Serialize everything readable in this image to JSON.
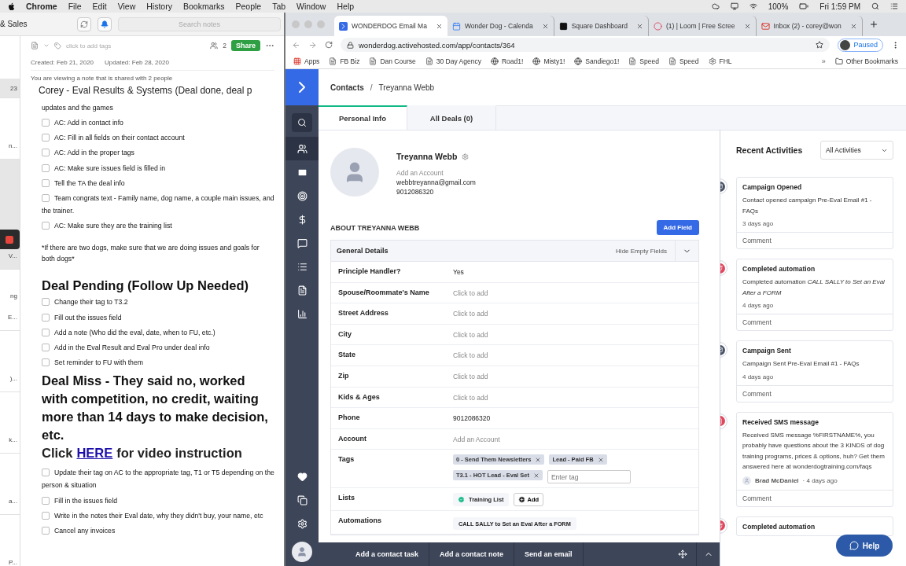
{
  "menubar": {
    "items": [
      {
        "label": "Chrome"
      },
      {
        "label": "File"
      },
      {
        "label": "Edit"
      },
      {
        "label": "View"
      },
      {
        "label": "History"
      },
      {
        "label": "Bookmarks"
      },
      {
        "label": "People"
      },
      {
        "label": "Tab"
      },
      {
        "label": "Window"
      },
      {
        "label": "Help"
      }
    ],
    "battery": "100%",
    "clock": "Fri 1:59 PM"
  },
  "notes_app": {
    "notebook": "& Sales",
    "search": {
      "placeholder": "Search notes"
    },
    "note_list": [
      {
        "lines": [
          "23"
        ],
        "kind": "date"
      },
      {
        "lines": [
          "n..."
        ],
        "kind": "snippet"
      },
      {
        "lines": [
          "V..."
        ],
        "kind": "active"
      },
      {
        "lines": [
          "ng",
          "E..."
        ],
        "kind": "snippet"
      },
      {
        "lines": [
          ")..."
        ],
        "kind": "snippet"
      },
      {
        "lines": [
          "k..."
        ],
        "kind": "snippet"
      },
      {
        "lines": [
          "a..."
        ],
        "kind": "snippet"
      },
      {
        "lines": [
          "P..."
        ],
        "kind": "snippet"
      }
    ],
    "tags_placeholder": "click to add tags",
    "shared_count": "2",
    "share": "Share",
    "created": "Created: Feb 21, 2020",
    "updated": "Updated: Feb 28, 2020",
    "banner": "You are viewing a note that is shared with 2 people",
    "title": "Corey - Eval Results & Systems (Deal done, deal p",
    "blocks": [
      {
        "kind": "text",
        "text": "updates and the games"
      },
      {
        "kind": "check",
        "text": "AC: Add in contact info",
        "checked": false
      },
      {
        "kind": "check",
        "text": "AC: Fill in all fields on their contact account",
        "checked": false
      },
      {
        "kind": "check",
        "text": "AC: Add in the proper tags",
        "checked": false
      },
      {
        "kind": "check",
        "text": "AC: Make sure issues field is filled in",
        "checked": false
      },
      {
        "kind": "check",
        "text": "Tell the TA the deal info",
        "checked": false
      },
      {
        "kind": "check",
        "text": "Team congrats text - Family name, dog name, a couple main issues, and the trainer.",
        "checked": false
      },
      {
        "kind": "check",
        "text": "AC: Make sure they are the training list",
        "checked": false
      },
      {
        "kind": "note",
        "text": "*If there are two dogs, make sure that we are doing issues and goals for both dogs*"
      },
      {
        "kind": "heading",
        "text": "Deal Pending (Follow Up Needed)"
      },
      {
        "kind": "check",
        "text": "Change their tag to T3.2",
        "checked": false
      },
      {
        "kind": "check",
        "text": "Fill out the issues field",
        "checked": false
      },
      {
        "kind": "check",
        "text": "Add a note (Who did the eval, date, when to FU, etc.)",
        "checked": false
      },
      {
        "kind": "check",
        "text": "Add in the Eval Result and Eval Pro under deal info",
        "checked": false
      },
      {
        "kind": "check",
        "text": "Set reminder to FU with them",
        "checked": false
      },
      {
        "kind": "heading",
        "text": "Deal Miss - They said no, worked with competition, no credit, waiting more than 14 days to make decision, etc."
      },
      {
        "kind": "link_heading",
        "before": "Click",
        "link": "HERE",
        "after": "for video instruction"
      },
      {
        "kind": "check",
        "text": "Update their tag on AC to the appropriate tag, T1 or T5 depending on the person & situation",
        "checked": false
      },
      {
        "kind": "check",
        "text": "Fill in the issues field",
        "checked": false
      },
      {
        "kind": "check",
        "text": "Write in the notes their Eval date, why they didn't buy, your name, etc",
        "checked": false
      },
      {
        "kind": "check",
        "text": "Cancel any invoices",
        "checked": false
      }
    ]
  },
  "browser": {
    "tabs": [
      {
        "title": "WONDERDOG Email Ma",
        "kind": "arrow",
        "selected": true
      },
      {
        "title": "Wonder Dog - Calenda",
        "kind": "calendar",
        "selected": false
      },
      {
        "title": "Square Dashboard",
        "kind": "square",
        "selected": false
      },
      {
        "title": "(1) | Loom | Free Scree",
        "kind": "loom",
        "selected": false
      },
      {
        "title": "Inbox (2) - corey@won",
        "kind": "mail",
        "selected": false
      }
    ],
    "url": "wonderdog.activehosted.com/app/contacts/364",
    "profile": "Paused",
    "bookmarks": [
      {
        "label": "Apps",
        "kind": "apps"
      },
      {
        "label": "FB Biz",
        "kind": "page"
      },
      {
        "label": "Dan Course",
        "kind": "page"
      },
      {
        "label": "30 Day Agency",
        "kind": "page"
      },
      {
        "label": "Road1!",
        "kind": "globe"
      },
      {
        "label": "Misty1!",
        "kind": "globe"
      },
      {
        "label": "Sandiego1!",
        "kind": "globe"
      },
      {
        "label": "Speed",
        "kind": "page"
      },
      {
        "label": "Speed",
        "kind": "page"
      },
      {
        "label": "FHL",
        "kind": "gear"
      }
    ],
    "more": "»",
    "other_bookmarks": "Other Bookmarks"
  },
  "crm": {
    "breadcrumb": [
      "Contacts",
      "Treyanna Webb"
    ],
    "breadcrumb_separator": "/",
    "tabs": [
      {
        "label": "Personal Info",
        "selected": true
      },
      {
        "label": "All Deals (0)",
        "selected": false
      }
    ],
    "contact": {
      "name": "Treyanna Webb",
      "account": "Add an Account",
      "email": "webbtreyanna@gmail.com",
      "phone": "9012086320"
    },
    "about_title": "ABOUT TREYANNA WEBB",
    "add_field": "Add Field",
    "section": "General Details",
    "hide_empty": "Hide Empty Fields",
    "fields": [
      {
        "label": "Principle Handler?",
        "kind": "value",
        "value": "Yes"
      },
      {
        "label": "Spouse/Roommate's Name",
        "kind": "empty",
        "placeholder": "Click to add"
      },
      {
        "label": "Street Address",
        "kind": "empty",
        "placeholder": "Click to add"
      },
      {
        "label": "City",
        "kind": "empty",
        "placeholder": "Click to add"
      },
      {
        "label": "State",
        "kind": "empty",
        "placeholder": "Click to add"
      },
      {
        "label": "Zip",
        "kind": "empty",
        "placeholder": "Click to add"
      },
      {
        "label": "Kids & Ages",
        "kind": "empty",
        "placeholder": "Click to add"
      },
      {
        "label": "Phone",
        "kind": "value",
        "value": "9012086320"
      },
      {
        "label": "Account",
        "kind": "empty",
        "placeholder": "Add an Account"
      },
      {
        "label": "Tags",
        "kind": "tags",
        "tags": [
          "0 - Send Them Newsletters",
          "Lead - Paid FB",
          "T3.1 - HOT Lead - Eval Set"
        ],
        "placeholder": "Enter tag"
      },
      {
        "label": "Lists",
        "kind": "lists",
        "lists": [
          "Training List"
        ],
        "add": "Add"
      },
      {
        "label": "Automations",
        "kind": "automation",
        "value": "CALL SALLY to Set an Eval After a FORM"
      }
    ],
    "footer": [
      "Add a contact task",
      "Add a contact note",
      "Send an email"
    ],
    "activities": {
      "title": "Recent Activities",
      "filter": "All Activities",
      "items": [
        {
          "kind": "email",
          "title": "Campaign Opened",
          "body": "Contact opened campaign Pre-Eval Email #1 - FAQs",
          "time": "3 days ago",
          "comment": "Comment"
        },
        {
          "kind": "automation",
          "title": "Completed automation",
          "body": "Completed automation *CALL SALLY to Set an Eval After a FORM*",
          "time": "4 days ago",
          "comment": "Comment"
        },
        {
          "kind": "email",
          "title": "Campaign Sent",
          "body": "Campaign Sent Pre-Eval Email #1 - FAQs",
          "time": "4 days ago",
          "comment": "Comment"
        },
        {
          "kind": "sms",
          "title": "Received SMS message",
          "body": "Received SMS message %FIRSTNAME%, you probably have questions about the 3 KINDS of dog training programs, prices & options, huh? Get them answered here at wonderdogtraining.com/faqs",
          "author": "Brad McDaniel",
          "time": "· 4 days ago",
          "comment": "Comment"
        },
        {
          "kind": "automation",
          "title": "Completed automation"
        }
      ]
    },
    "help": "Help"
  }
}
